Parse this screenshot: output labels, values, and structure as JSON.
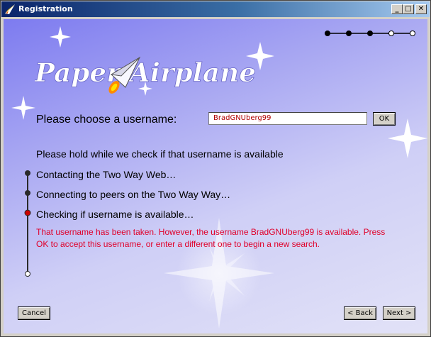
{
  "window": {
    "title": "Registration"
  },
  "titlebar_buttons": {
    "minimize": "_",
    "maximize": "□",
    "close": "✕"
  },
  "logo": {
    "text": "Paper Airplane"
  },
  "wizard": {
    "total_steps": 5,
    "completed_steps": 3
  },
  "username": {
    "label": "Please choose a username:",
    "value": "BradGNUberg99",
    "ok_label": "OK"
  },
  "status": {
    "heading": "Please hold while we check if that username is available",
    "steps": [
      {
        "label": "Contacting the Two Way Web…",
        "state": "done"
      },
      {
        "label": "Connecting to peers on the Two Way Way…",
        "state": "done"
      },
      {
        "label": "Checking if username is available…",
        "state": "current"
      }
    ],
    "message": "That username has been taken. However, the username BradGNUberg99 is available. Press OK to accept this username, or enter a different one to begin a new search."
  },
  "buttons": {
    "cancel": "Cancel",
    "back": "< Back",
    "next": "Next >"
  },
  "colors": {
    "error": "#e0002a",
    "current_step": "#cc0000",
    "done_step": "#222222"
  }
}
